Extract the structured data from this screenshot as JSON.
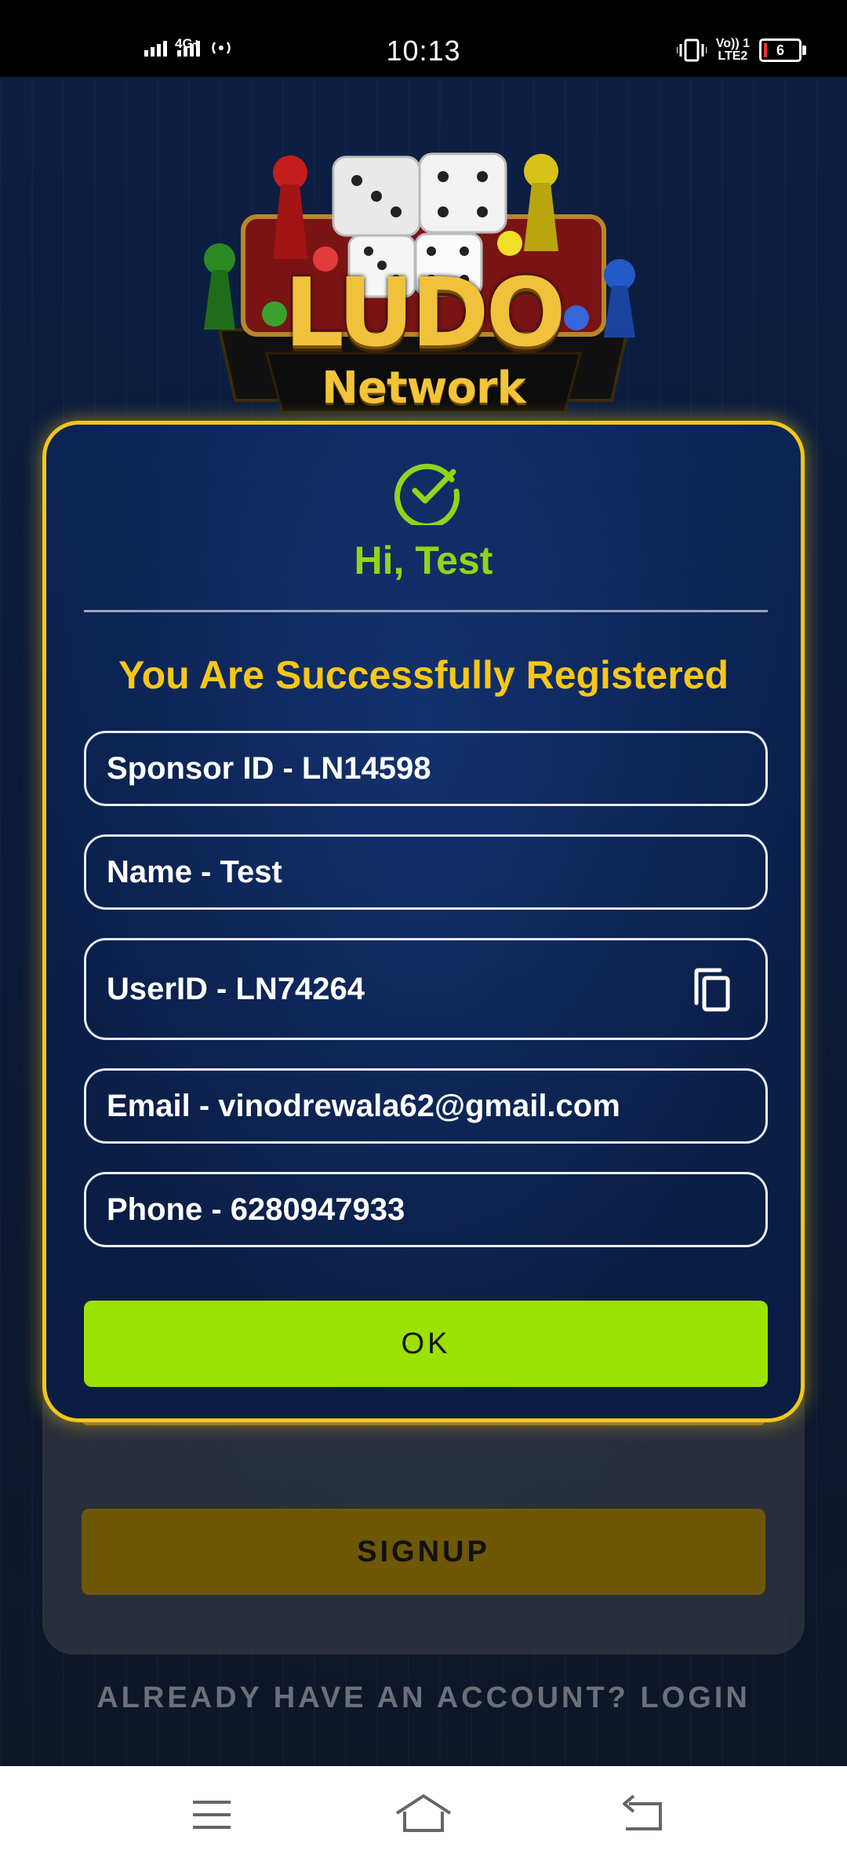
{
  "status_bar": {
    "time": "10:13",
    "network_type": "4G+",
    "sim2_label_top": "Vo)) 1",
    "sim2_label_bottom": "LTE2",
    "battery_level": "6",
    "icons": [
      "signal-icon",
      "wifi-calling-icon",
      "vibrate-icon",
      "battery-icon"
    ]
  },
  "logo": {
    "word_top": "LUDO",
    "word_bottom": "Network"
  },
  "modal": {
    "greeting": "Hi, Test",
    "success_message": "You Are Successfully Registered",
    "fields": {
      "sponsor": "Sponsor ID - LN14598",
      "name": "Name - Test",
      "userid": "UserID - LN74264",
      "email": "Email - vinodrewala62@gmail.com",
      "phone": "Phone - 6280947933"
    },
    "ok_label": "OK",
    "icons": [
      "check-circle-icon",
      "copy-icon"
    ]
  },
  "background_form": {
    "signup_label": "SIGNUP",
    "login_link": "ALREADY HAVE AN ACCOUNT? LOGIN"
  },
  "nav_bar": {
    "icons": [
      "menu-icon",
      "home-icon",
      "back-icon"
    ]
  },
  "colors": {
    "accent_gold": "#f2c61a",
    "accent_green": "#9be202",
    "greeting_green": "#8fd61a",
    "background_navy": "#0b1d42"
  }
}
